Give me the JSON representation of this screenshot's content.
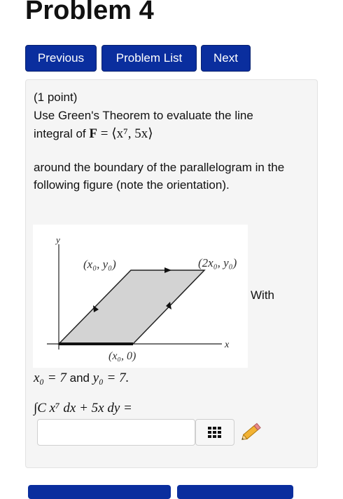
{
  "header": {
    "title": "Problem 4"
  },
  "nav": {
    "previous": "Previous",
    "problem_list": "Problem List",
    "next": "Next"
  },
  "problem": {
    "points": "(1 point)",
    "line1": "Use Green's Theorem to evaluate the line",
    "line2_prefix": "integral of",
    "vector_field_symbol": "F",
    "vector_field_eq": "= ⟨x⁷, 5x⟩",
    "line3": "around the boundary of the parallelogram in the",
    "line4": "following figure (note the orientation).",
    "with_text": "With",
    "x0_eq": "x₀ = 7",
    "and": "and",
    "y0_eq": "y₀ = 7.",
    "integral_expr": "∫C x⁷ dx + 5x dy ="
  },
  "figure": {
    "y_axis_label": "y",
    "x_axis_label": "x",
    "label_top_left": "(x₀, y₀)",
    "label_top_right": "(2x₀, y₀)",
    "label_bottom": "(x₀, 0)"
  },
  "answer": {
    "value": "",
    "placeholder": ""
  },
  "icons": {
    "palette": "grid-icon",
    "edit": "pencil-icon"
  },
  "colors": {
    "button": "#0a2e9e",
    "panel": "#f5f5f5",
    "shape": "#d3d3d3"
  }
}
